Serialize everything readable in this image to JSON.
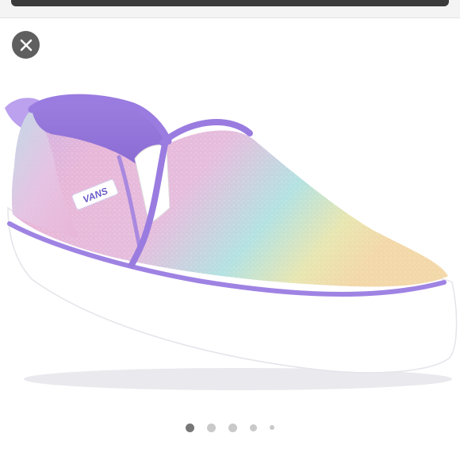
{
  "viewer": {
    "close_icon": "close-icon",
    "product": {
      "brand_label": "VANS",
      "colors": {
        "lavender": "#a78be0",
        "purple_trim": "#8d6fd9",
        "pink": "#e6b3d8",
        "mint": "#aee6e0",
        "yellow": "#f0e3a6",
        "sole": "#ffffff"
      }
    },
    "carousel": {
      "total": 5,
      "active_index": 0
    }
  }
}
